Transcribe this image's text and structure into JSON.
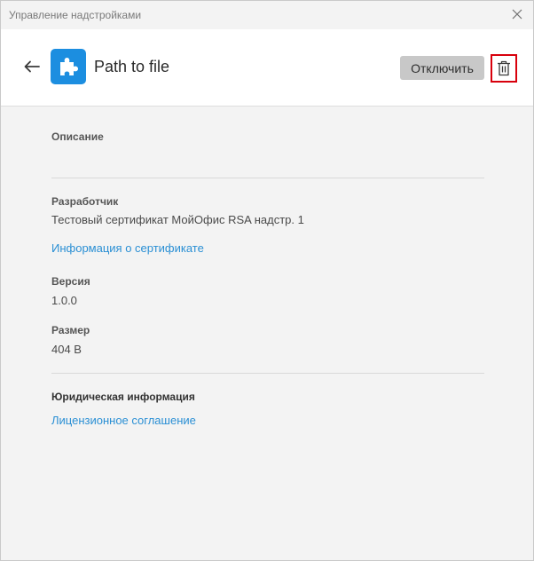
{
  "window": {
    "title": "Управление надстройками"
  },
  "header": {
    "addin_name": "Path to file",
    "disable_label": "Отключить"
  },
  "details": {
    "description_label": "Описание",
    "developer_label": "Разработчик",
    "developer_value": "Тестовый сертификат МойОфис RSA надстр. 1",
    "certificate_link": "Информация о сертификате",
    "version_label": "Версия",
    "version_value": "1.0.0",
    "size_label": "Размер",
    "size_value": "404 B",
    "legal_label": "Юридическая информация",
    "license_link": "Лицензионное соглашение"
  },
  "icons": {
    "close": "close-icon",
    "back": "arrow-left-icon",
    "addin": "puzzle-icon",
    "delete": "trash-icon"
  },
  "colors": {
    "addin_icon_bg": "#1c8ee0",
    "link": "#2a8fd4",
    "delete_highlight": "#d8000c",
    "disable_button_bg": "#c8c8c8"
  }
}
